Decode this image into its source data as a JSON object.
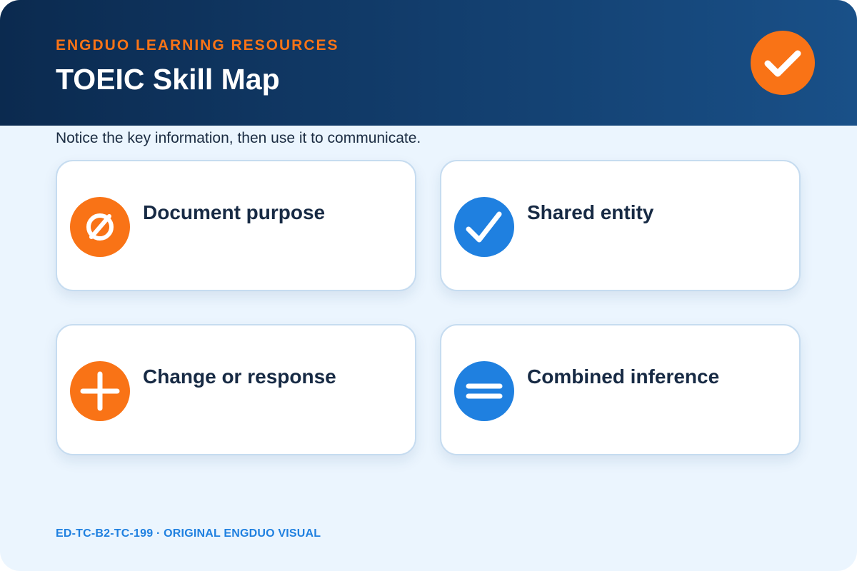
{
  "header": {
    "eyebrow": "ENGDUO LEARNING RESOURCES",
    "title": "TOEIC Skill Map",
    "badge_icon": "checkmark-icon",
    "badge_color": "#f97316"
  },
  "subtitle": "Notice the key information, then use it to communicate.",
  "cards": [
    {
      "label": "Document purpose",
      "icon": "empty-set-icon",
      "color": "#f97316"
    },
    {
      "label": "Shared entity",
      "icon": "checkmark-icon",
      "color": "#1f80e0"
    },
    {
      "label": "Change or response",
      "icon": "plus-icon",
      "color": "#f97316"
    },
    {
      "label": "Combined inference",
      "icon": "equals-icon",
      "color": "#1f80e0"
    }
  ],
  "footer": "ED-TC-B2-TC-199 · ORIGINAL ENGDUO VISUAL",
  "colors": {
    "header_dark": "#0b2a4f",
    "header_light": "#195088",
    "accent_orange": "#f97316",
    "accent_blue": "#1f80e0",
    "background": "#ebf5fe"
  }
}
